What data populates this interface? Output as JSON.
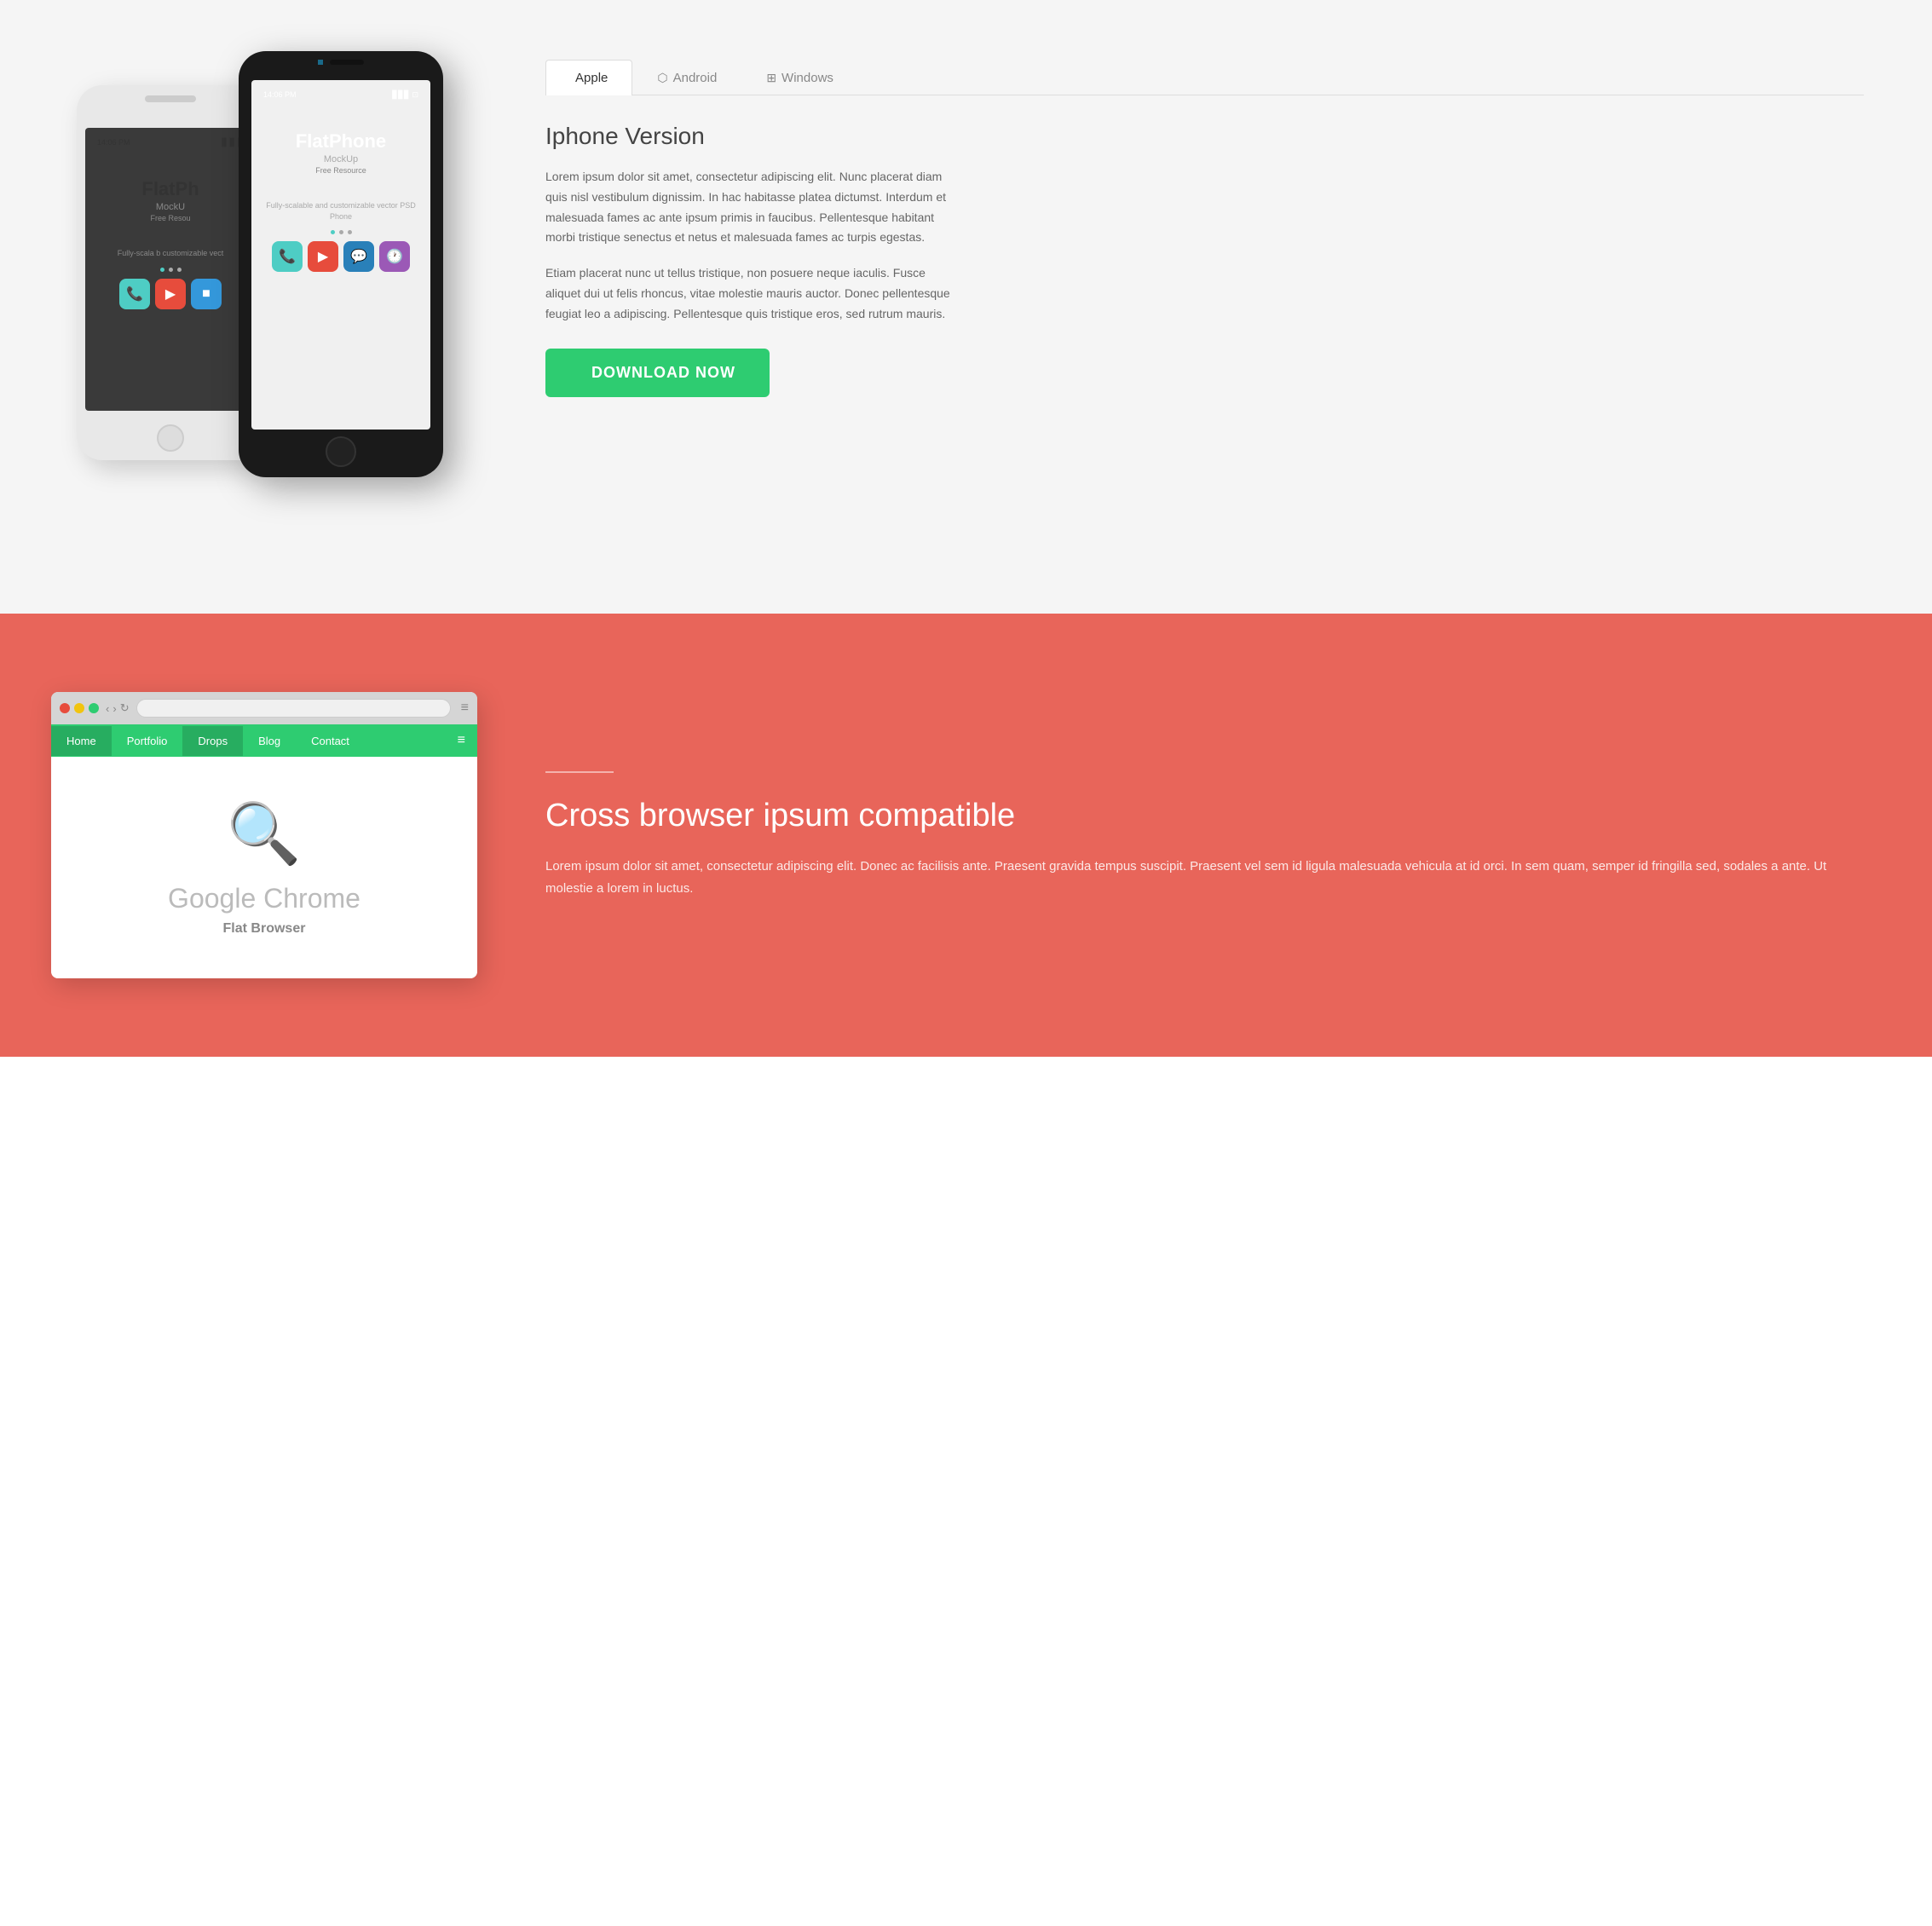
{
  "tabs": {
    "items": [
      {
        "id": "apple",
        "label": "Apple",
        "icon": "",
        "active": true
      },
      {
        "id": "android",
        "label": "Android",
        "icon": "⬡",
        "active": false
      },
      {
        "id": "windows",
        "label": "Windows",
        "icon": "⊞",
        "active": false
      }
    ]
  },
  "phone_section": {
    "title": "Iphone Version",
    "body1": "Lorem ipsum dolor sit amet, consectetur adipiscing elit. Nunc placerat diam quis nisl vestibulum dignissim. In hac habitasse platea dictumst. Interdum et malesuada fames ac ante ipsum primis in faucibus. Pellentesque habitant morbi tristique senectus et netus et malesuada fames ac turpis egestas.",
    "body2": "Etiam placerat nunc ut tellus tristique, non posuere neque iaculis. Fusce aliquet dui ut felis rhoncus, vitae molestie mauris auctor. Donec pellentesque feugiat leo a adipiscing. Pellentesque quis tristique eros, sed rutrum mauris.",
    "download_button": "DOWNLOAD NOW",
    "phone_black": {
      "status_time": "14:06 PM",
      "app_name": "FlatPhone",
      "app_sub": "MockUp",
      "app_label": "Free Resource",
      "app_desc": "Fully-scalable and\ncustomizable vector PSD Phone"
    },
    "phone_white": {
      "status_time": "14:06 PM",
      "app_name": "FlatPh",
      "app_sub": "MockU",
      "app_label": "Free Resou",
      "app_desc": "Fully-scala b\ncustomizable vect"
    }
  },
  "browser_section": {
    "heading": "Cross browser ipsum compatible",
    "body": "Lorem ipsum dolor sit amet, consectetur adipiscing elit. Donec ac facilisis ante. Praesent gravida tempus suscipit. Praesent vel sem id ligula malesuada vehicula at id orci. In sem quam, semper id fringilla sed, sodales a ante. Ut molestie a lorem in luctus.",
    "nav_items": [
      "Home",
      "Portfolio",
      "Drops",
      "Blog",
      "Contact"
    ],
    "active_nav": "Drops",
    "browser_app_title": "Google Chrome",
    "browser_app_subtitle": "Flat Browser"
  }
}
